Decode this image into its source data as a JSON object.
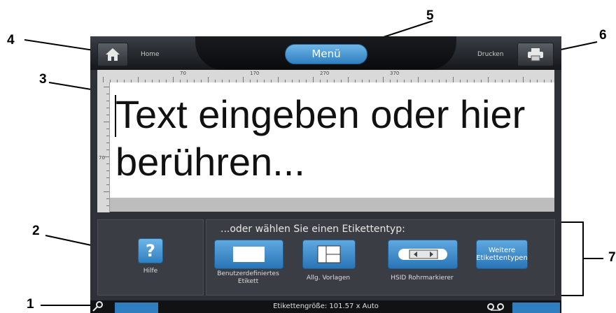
{
  "callouts": [
    "1",
    "2",
    "3",
    "4",
    "5",
    "6",
    "7"
  ],
  "header": {
    "home_label": "Home",
    "menu_label": "Menü",
    "print_label": "Drucken"
  },
  "ruler": {
    "top_numbers": [
      "70",
      "170",
      "270",
      "370"
    ],
    "left_numbers": [
      "70"
    ]
  },
  "editor": {
    "placeholder": "Text eingeben oder hier berühren..."
  },
  "help": {
    "label": "Hilfe",
    "icon": "?"
  },
  "label_types": {
    "title": "...oder wählen Sie einen Etikettentyp:",
    "items": [
      {
        "label": "Benutzerdefiniertes Etikett",
        "icon": "blank-label-icon"
      },
      {
        "label": "Allg. Vorlagen",
        "icon": "template-layout-icon"
      },
      {
        "label": "HSID Rohrmarkierer",
        "icon": "pipe-marker-icon"
      },
      {
        "label": "Weitere Etikettentypen",
        "icon": ""
      }
    ]
  },
  "status": {
    "label_size": "Etikettengröße: 101.57 x Auto"
  },
  "colors": {
    "accent": "#2f7fc0",
    "frame": "#2e3238"
  }
}
